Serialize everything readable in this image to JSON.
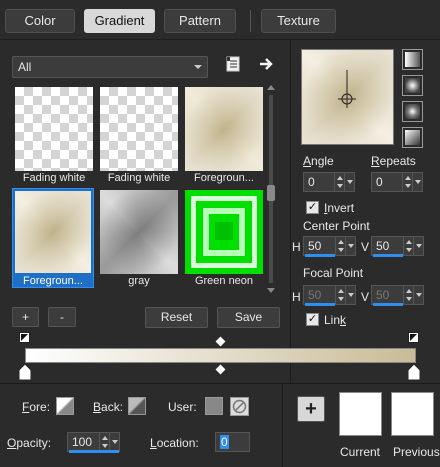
{
  "tabs": [
    {
      "label": "Color"
    },
    {
      "label": "Gradient",
      "active": true
    },
    {
      "label": "Pattern"
    },
    {
      "label": "Texture"
    }
  ],
  "filter": {
    "selected": "All"
  },
  "gradients": [
    {
      "label": "Fading white"
    },
    {
      "label": "Fading white"
    },
    {
      "label": "Foregroun..."
    },
    {
      "label": "Foregroun...",
      "selected": true
    },
    {
      "label": "gray"
    },
    {
      "label": "Green neon"
    }
  ],
  "buttons": {
    "add": "+",
    "remove": "-",
    "reset": "Reset",
    "save": "Save"
  },
  "angle": {
    "label_pre": "",
    "label_ul": "A",
    "label_post": "ngle",
    "value": "0"
  },
  "repeats": {
    "label_pre": "",
    "label_ul": "R",
    "label_post": "epeats",
    "value": "0"
  },
  "invert": {
    "label_pre": "",
    "label_ul": "I",
    "label_post": "nvert",
    "checked": true
  },
  "center_point": {
    "label": "Center Point",
    "h_label": "H",
    "h_value": "50",
    "v_label": "V",
    "v_value": "50"
  },
  "focal_point": {
    "label": "Focal Point",
    "h_label": "H",
    "h_value": "50",
    "v_label": "V",
    "v_value": "50"
  },
  "link": {
    "label_pre": "Lin",
    "label_ul": "k",
    "label_post": "",
    "checked": true
  },
  "bottom": {
    "fore_label_ul": "F",
    "fore_label_post": "ore:",
    "back_label_ul": "B",
    "back_label_post": "ack:",
    "user_label": "User:",
    "opacity_label_ul": "O",
    "opacity_label_post": "pacity:",
    "opacity_value": "100",
    "location_label_ul": "L",
    "location_label_post": "ocation:",
    "location_value": "0",
    "current_label": "Current",
    "previous_label": "Previous",
    "add_button": "+"
  },
  "colors": {
    "accent": "#2f8ef0",
    "gradient_start": "#ffffff",
    "gradient_end": "#c8bb96",
    "selection": "#1f6fc5",
    "neon": "#00ff00"
  }
}
